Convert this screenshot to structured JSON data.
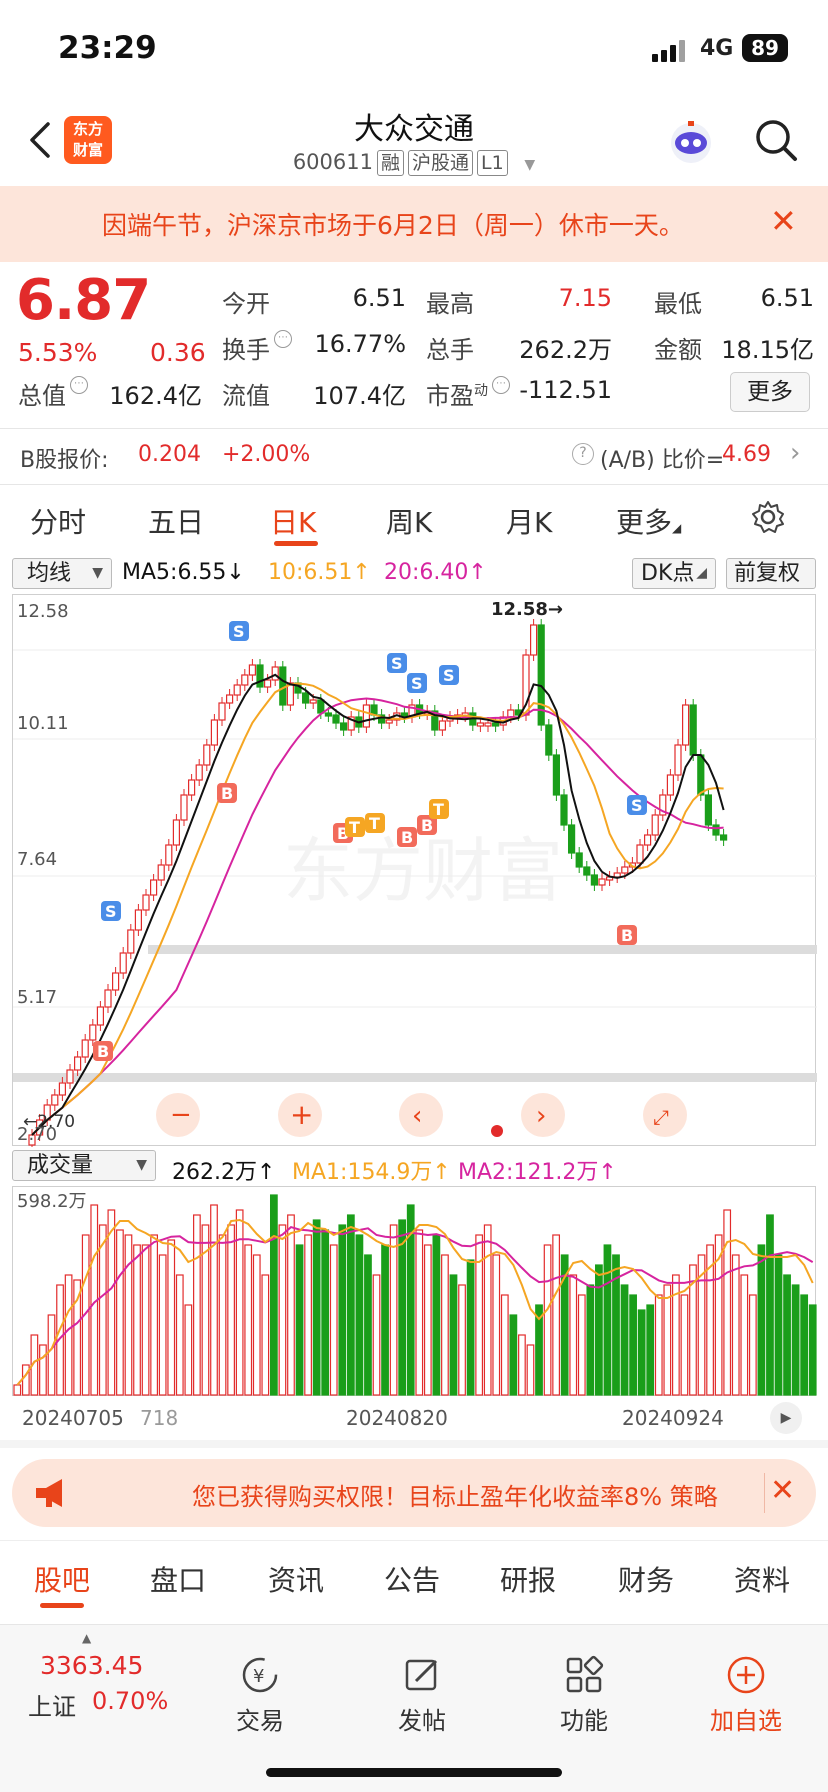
{
  "status": {
    "time": "23:29",
    "network": "4G",
    "battery": "89"
  },
  "header": {
    "title": "大众交通",
    "code": "600611",
    "tags": [
      "融",
      "沪股通",
      "L1"
    ],
    "logo_line1": "东方",
    "logo_line2": "财富"
  },
  "notice": {
    "text": "因端午节，沪深京市场于6月2日（周一）休市一天。",
    "close": "✕"
  },
  "quote": {
    "price": "6.87",
    "change_pct": "5.53%",
    "change": "0.36",
    "open_label": "今开",
    "open": "6.51",
    "high_label": "最高",
    "high": "7.15",
    "low_label": "最低",
    "low": "6.51",
    "turnover_label": "换手",
    "turnover": "16.77%",
    "volume_label": "总手",
    "volume": "262.2万",
    "amount_label": "金额",
    "amount": "18.15亿",
    "mktcap_label": "总值",
    "mktcap": "162.4亿",
    "float_label": "流值",
    "float": "107.4亿",
    "pe_label": "市盈",
    "pe_sup": "动",
    "pe": "-112.51",
    "more": "更多"
  },
  "bshare": {
    "label": "B股报价:",
    "price": "0.204",
    "pct": "+2.00%",
    "ratio_label": "(A/B) 比价=",
    "ratio": "4.69"
  },
  "ktabs": [
    "分时",
    "五日",
    "日K",
    "周K",
    "月K",
    "更多"
  ],
  "ktab_active": "日K",
  "chart_bar": {
    "ma_select": "均线",
    "ma5": "MA5:6.55↓",
    "ma10": "10:6.51↑",
    "ma20": "20:6.40↑",
    "dk": "DK点",
    "fq": "前复权"
  },
  "chart_data": {
    "type": "candlestick",
    "y_ticks": [
      "12.58",
      "10.11",
      "7.64",
      "5.17",
      "2.70"
    ],
    "ylim": [
      2.7,
      12.58
    ],
    "max_label": "12.58→",
    "min_label": "←2.70"
  },
  "vol_bar": {
    "select": "成交量",
    "vol": "262.2万↑",
    "ma1": "MA1:154.9万↑",
    "ma2": "MA2:121.2万↑",
    "max": "598.2万"
  },
  "dates": [
    "20240705",
    "718",
    "20240820",
    "20240924"
  ],
  "promo": {
    "text": "您已获得购买权限！目标止盈年化收益率8% 策略",
    "close": "✕"
  },
  "btabs": [
    "股吧",
    "盘口",
    "资讯",
    "公告",
    "研报",
    "财务",
    "资料"
  ],
  "footer": {
    "index_price": "3363.45",
    "index_name": "上证",
    "index_pct": "0.70%",
    "trade": "交易",
    "post": "发帖",
    "func": "功能",
    "add": "加自选"
  },
  "colors": {
    "up": "#e22b2b",
    "down": "#1a9e1a",
    "accent": "#e8441a",
    "ma5": "#111111",
    "ma10": "#f5a623",
    "ma20": "#d6249f"
  }
}
